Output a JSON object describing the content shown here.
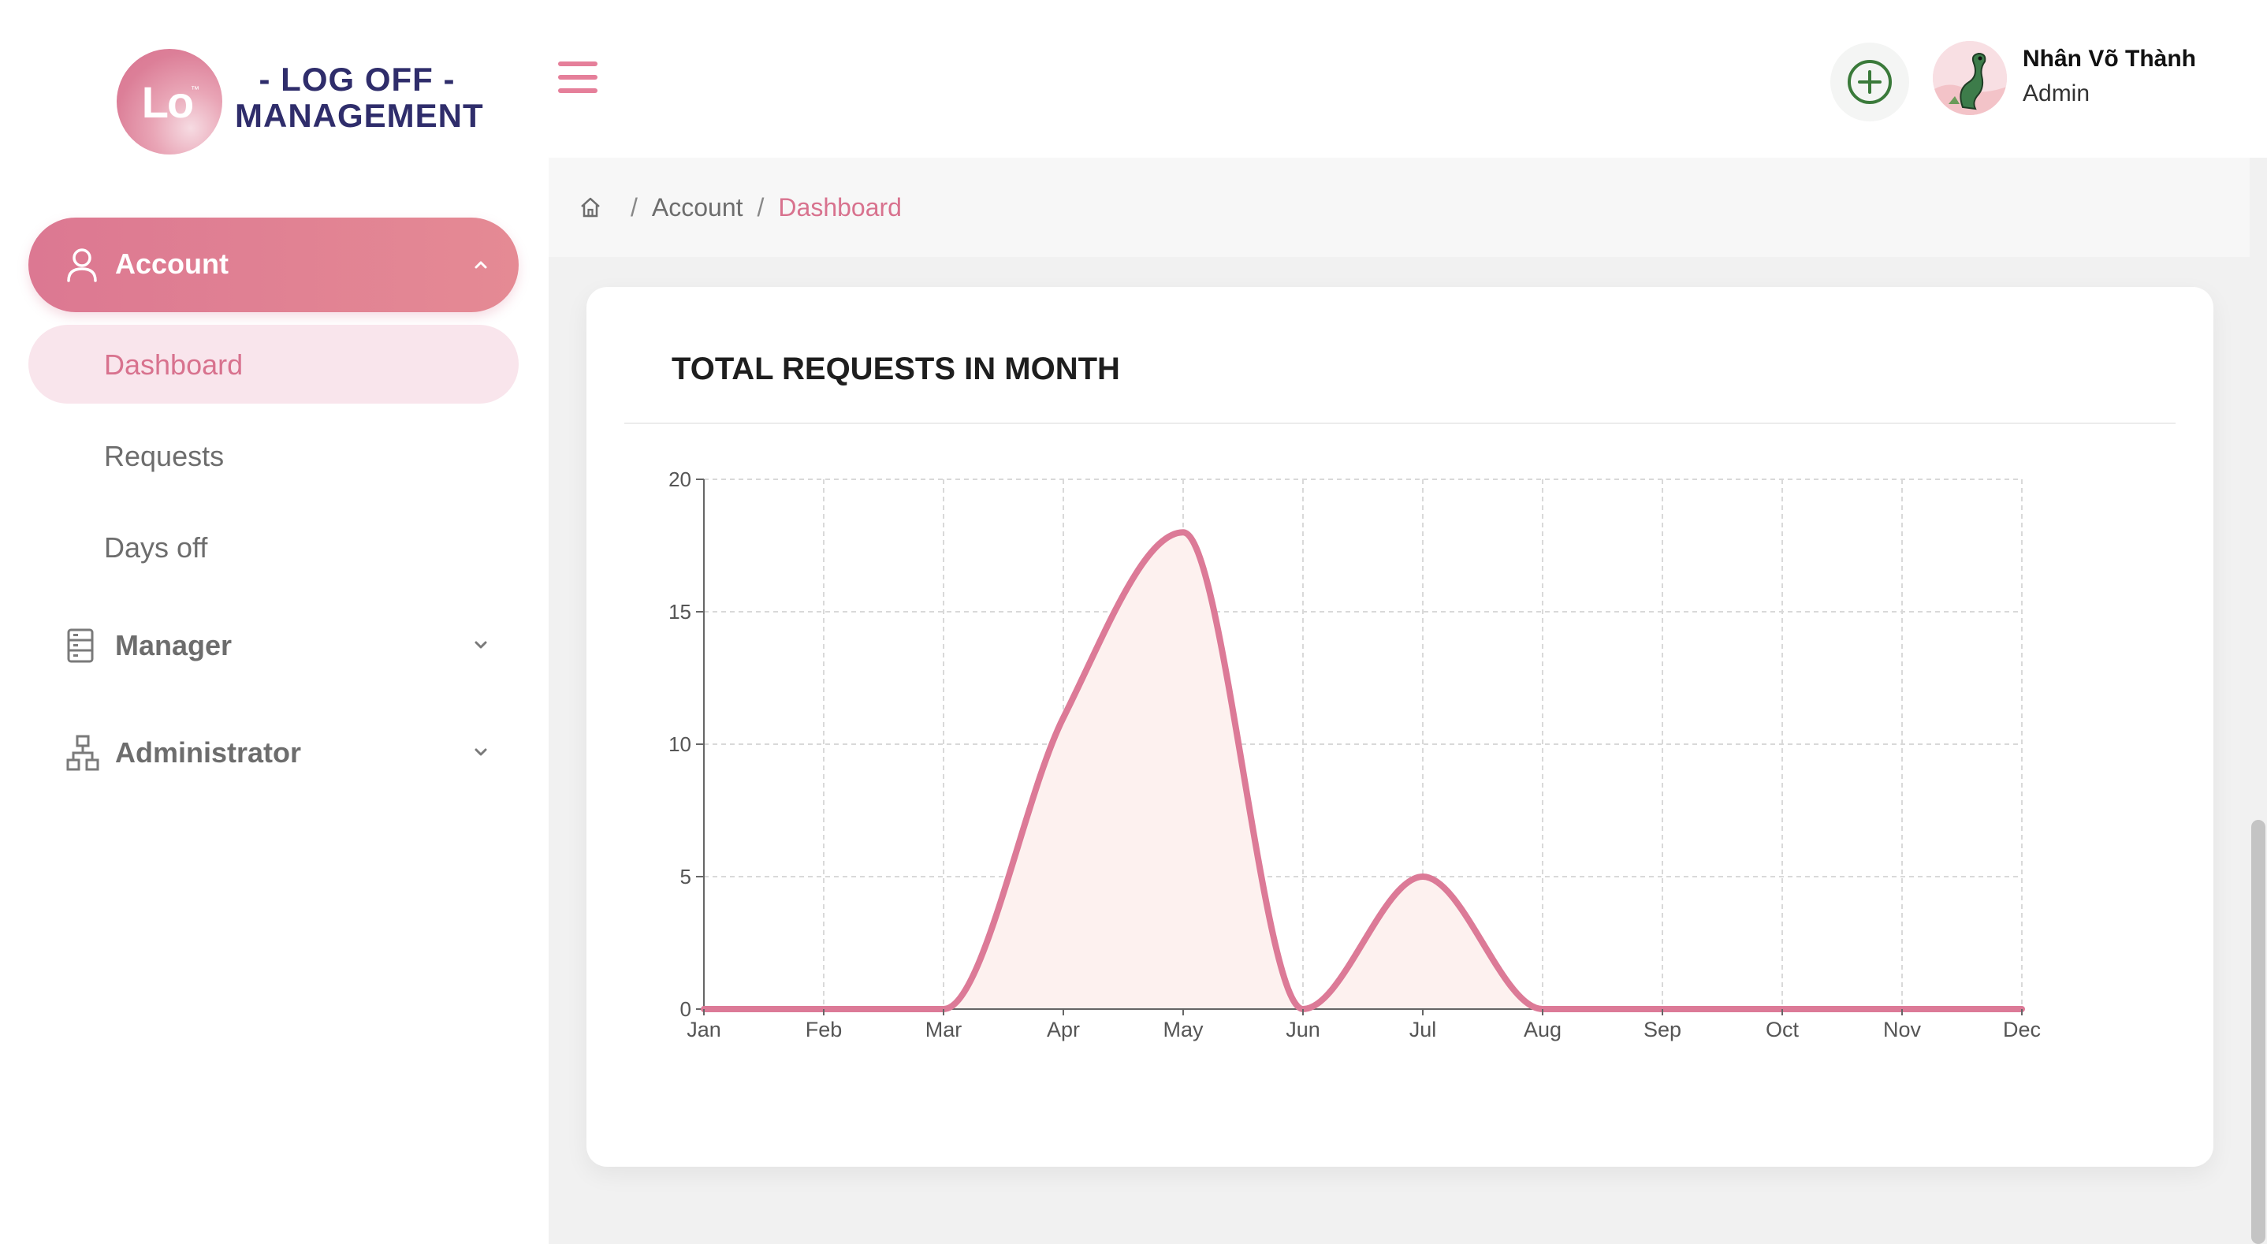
{
  "header": {
    "logo_text": "Lo",
    "logo_mark": "™",
    "brand_line1": "- LOG OFF -",
    "brand_line2": "MANAGEMENT",
    "menu_icon": "hamburger-icon",
    "add_icon": "plus-circle-icon",
    "user": {
      "name": "Nhân Võ Thành",
      "role": "Admin"
    }
  },
  "sidebar": {
    "account": {
      "label": "Account",
      "icon": "user-icon",
      "expanded": true
    },
    "sub_items": [
      {
        "label": "Dashboard",
        "active": true
      },
      {
        "label": "Requests",
        "active": false
      },
      {
        "label": "Days off",
        "active": false
      }
    ],
    "groups": [
      {
        "label": "Manager",
        "icon": "server-list-icon"
      },
      {
        "label": "Administrator",
        "icon": "hierarchy-icon"
      }
    ]
  },
  "breadcrumb": {
    "items": [
      "Account"
    ],
    "current": "Dashboard",
    "separator": "/"
  },
  "card": {
    "title": "TOTAL REQUESTS IN MONTH"
  },
  "colors": {
    "accent": "#d8728e",
    "line": "#dc7a97",
    "fill": "#fdf1ef",
    "brand": "#2f2d6b",
    "plus": "#3a7a3a"
  },
  "chart_data": {
    "type": "area",
    "title": "TOTAL REQUESTS IN MONTH",
    "categories": [
      "Jan",
      "Feb",
      "Mar",
      "Apr",
      "May",
      "Jun",
      "Jul",
      "Aug",
      "Sep",
      "Oct",
      "Nov",
      "Dec"
    ],
    "series": [
      {
        "values": [
          0,
          0,
          0,
          11,
          18,
          0,
          5,
          0,
          0,
          0,
          0,
          0
        ]
      }
    ],
    "y_ticks": [
      "0",
      "5",
      "10",
      "15",
      "20"
    ],
    "ylim": [
      0,
      20
    ],
    "grid": true,
    "smooth": true
  }
}
